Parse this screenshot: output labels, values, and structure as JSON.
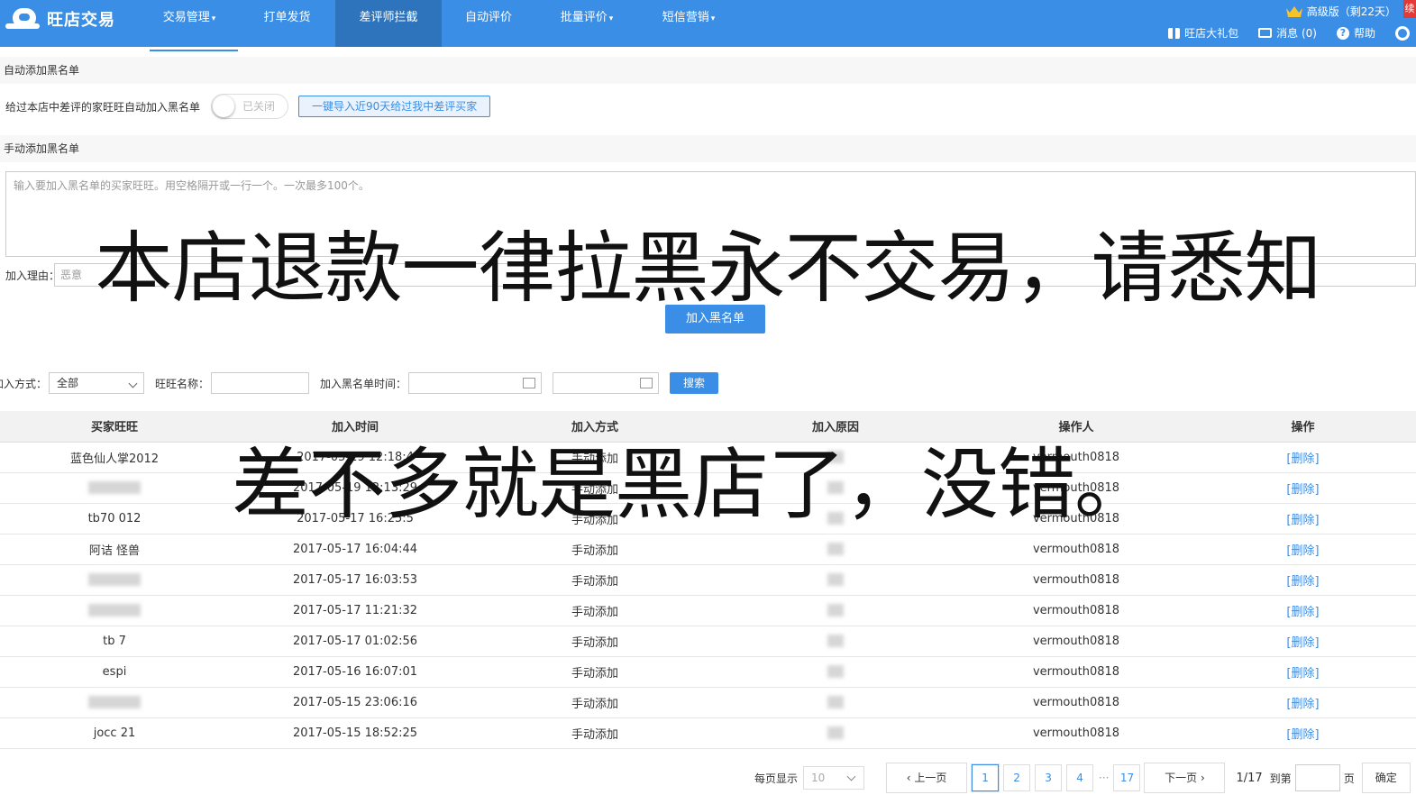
{
  "app": {
    "name": "旺店交易"
  },
  "nav": {
    "items": [
      {
        "label": "交易管理",
        "dropdown": true
      },
      {
        "label": "打单发货",
        "dropdown": false
      },
      {
        "label": "差评师拦截",
        "dropdown": false,
        "active": true
      },
      {
        "label": "自动评价",
        "dropdown": false
      },
      {
        "label": "批量评价",
        "dropdown": true
      },
      {
        "label": "短信营销",
        "dropdown": true
      }
    ]
  },
  "topright": {
    "version": "高级版（剩22天）",
    "gift": "旺店大礼包",
    "messages": "消息 (0)",
    "help": "帮助"
  },
  "auto_section": {
    "title": "自动添加黑名单",
    "desc": "给过本店中差评的家旺旺自动加入黑名单",
    "toggle_label": "已关闭",
    "import_button": "一键导入近90天给过我中差评买家"
  },
  "manual_section": {
    "title": "手动添加黑名单",
    "textarea_placeholder": "输入要加入黑名单的买家旺旺。用空格隔开或一行一个。一次最多100个。",
    "reason_label": "加入理由：",
    "reason_value": "恶意",
    "add_button": "加入黑名单"
  },
  "filter": {
    "method_label": "加入方式：",
    "method_value": "全部",
    "wangwang_label": "旺旺名称：",
    "time_label": "加入黑名单时间：",
    "search_button": "搜索"
  },
  "table": {
    "headers": [
      "买家旺旺",
      "加入时间",
      "加入方式",
      "加入原因",
      "操作人",
      "操作"
    ],
    "rows": [
      {
        "buyer": "蓝色仙人掌2012",
        "time": "2017-05-19 12:18:4",
        "method": "手动添加",
        "operator": "vermouth0818",
        "action": "[删除]"
      },
      {
        "buyer": "",
        "time": "2017-05-19 12:13:29",
        "method": "手动添加",
        "operator": "vermouth0818",
        "action": "[删除]"
      },
      {
        "buyer": "tb70  012",
        "time": "2017-05-17 16:25:5",
        "method": "手动添加",
        "operator": "vermouth0818",
        "action": "[删除]"
      },
      {
        "buyer": "阿诘 怪兽",
        "time": "2017-05-17 16:04:44",
        "method": "手动添加",
        "operator": "vermouth0818",
        "action": "[删除]"
      },
      {
        "buyer": "",
        "time": "2017-05-17 16:03:53",
        "method": "手动添加",
        "operator": "vermouth0818",
        "action": "[删除]"
      },
      {
        "buyer": "",
        "time": "2017-05-17 11:21:32",
        "method": "手动添加",
        "operator": "vermouth0818",
        "action": "[删除]"
      },
      {
        "buyer": "tb 7",
        "time": "2017-05-17 01:02:56",
        "method": "手动添加",
        "operator": "vermouth0818",
        "action": "[删除]"
      },
      {
        "buyer": "espi",
        "time": "2017-05-16 16:07:01",
        "method": "手动添加",
        "operator": "vermouth0818",
        "action": "[删除]"
      },
      {
        "buyer": "",
        "time": "2017-05-15 23:06:16",
        "method": "手动添加",
        "operator": "vermouth0818",
        "action": "[删除]"
      },
      {
        "buyer": "jocc 21",
        "time": "2017-05-15 18:52:25",
        "method": "手动添加",
        "operator": "vermouth0818",
        "action": "[删除]"
      }
    ]
  },
  "pager": {
    "per_page_label": "每页显示",
    "per_page_value": "10",
    "prev": "‹ 上一页",
    "pages": [
      "1",
      "2",
      "3",
      "4"
    ],
    "ellipsis": "···",
    "last": "17",
    "next": "下一页 ›",
    "info": "1/17",
    "goto_label": "到第",
    "page_unit": "页",
    "confirm": "确定"
  },
  "overlay": {
    "line1": "本店退款一律拉黑永不交易，请悉知",
    "line2": "差不多就是黑店了，没错。"
  },
  "colors": {
    "primary": "#3a8ee6",
    "nav_active": "#2d74bd",
    "link": "#3a8ee6"
  }
}
